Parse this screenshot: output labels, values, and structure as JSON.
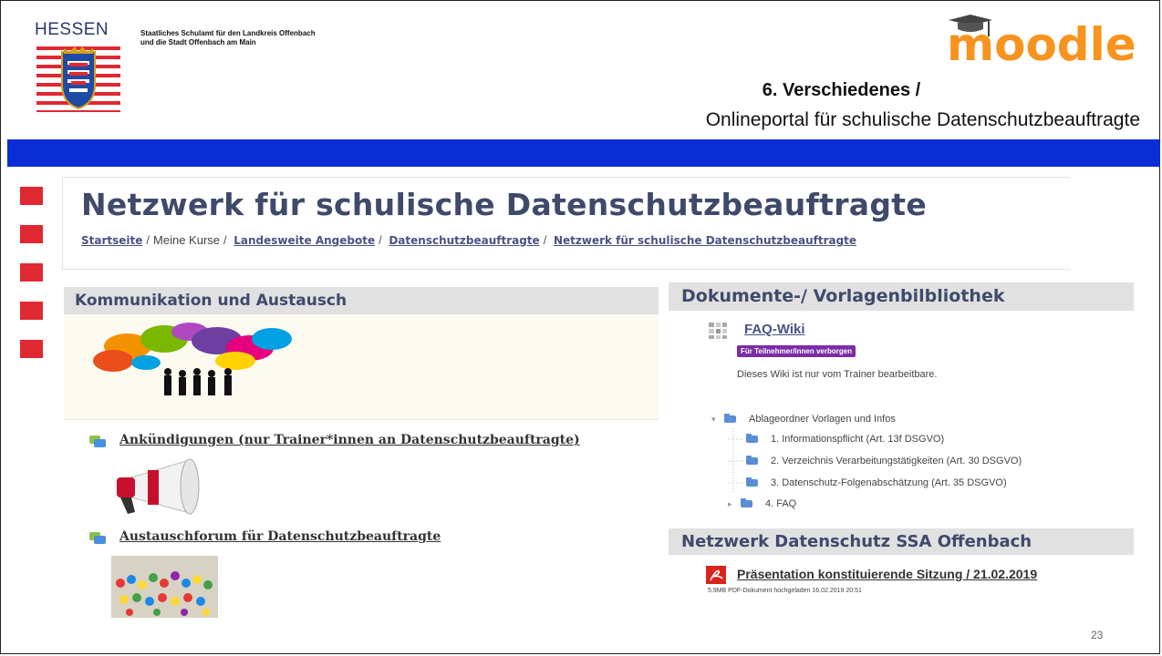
{
  "header": {
    "state_name": "HESSEN",
    "authority_line1": "Staatliches Schulamt für den Landkreis Offenbach",
    "authority_line2": "und die Stadt Offenbach am Main",
    "logo_text": "moodle",
    "slide_title": "6. Verschiedenes /",
    "slide_subtitle": "Onlineportal für schulische Datenschutzbeauftragte"
  },
  "course": {
    "title": "Netzwerk für schulische Datenschutzbeauftragte",
    "breadcrumb": [
      {
        "label": "Startseite",
        "link": true
      },
      {
        "label": "Meine Kurse",
        "link": false
      },
      {
        "label": "Landesweite Angebote",
        "link": true
      },
      {
        "label": "Datenschutzbeauftragte",
        "link": true
      },
      {
        "label": "Netzwerk für schulische Datenschutzbeauftragte",
        "link": true
      }
    ]
  },
  "left_section": {
    "heading": "Kommunikation und Austausch",
    "forums": [
      {
        "label": "Ankündigungen (nur Trainer*innen an Datenschutzbeauftragte)",
        "icon": "forum-icon"
      },
      {
        "label": "Austauschforum für Datenschutzbeauftragte",
        "icon": "forum-icon"
      }
    ]
  },
  "right_section": {
    "heading": "Dokumente-/ Vorlagenbilbliothek",
    "wiki_label": "FAQ-Wiki",
    "wiki_badge": "Für Teilnehmer/innen verborgen",
    "wiki_description": "Dieses Wiki ist nur vom Trainer bearbeitbare.",
    "folder_root": "Ablageordner Vorlagen und Infos",
    "folders": [
      "1. Informationspflicht (Art. 13f DSGVO)",
      "2. Verzeichnis Verarbeitungstätigkeiten (Art. 30 DSGVO)",
      "3. Datenschutz-Folgenabschätzung (Art. 35 DSGVO)",
      "4. FAQ"
    ]
  },
  "network_section": {
    "heading": "Netzwerk Datenschutz SSA Offenbach",
    "file_label": "Präsentation konstituierende Sitzung / 21.02.2019",
    "file_meta": "5.9MB PDF-Dokument hochgeladen 16.02.2019 20:51",
    "file_icon": "pdf-icon"
  },
  "slide_number": "23",
  "colors": {
    "blue_bar": "#0a2dd6",
    "bullet_red": "#e02832",
    "heading_text": "#3f4a6b",
    "moodle_orange": "#f7931e",
    "badge_purple": "#7b2ca6"
  }
}
